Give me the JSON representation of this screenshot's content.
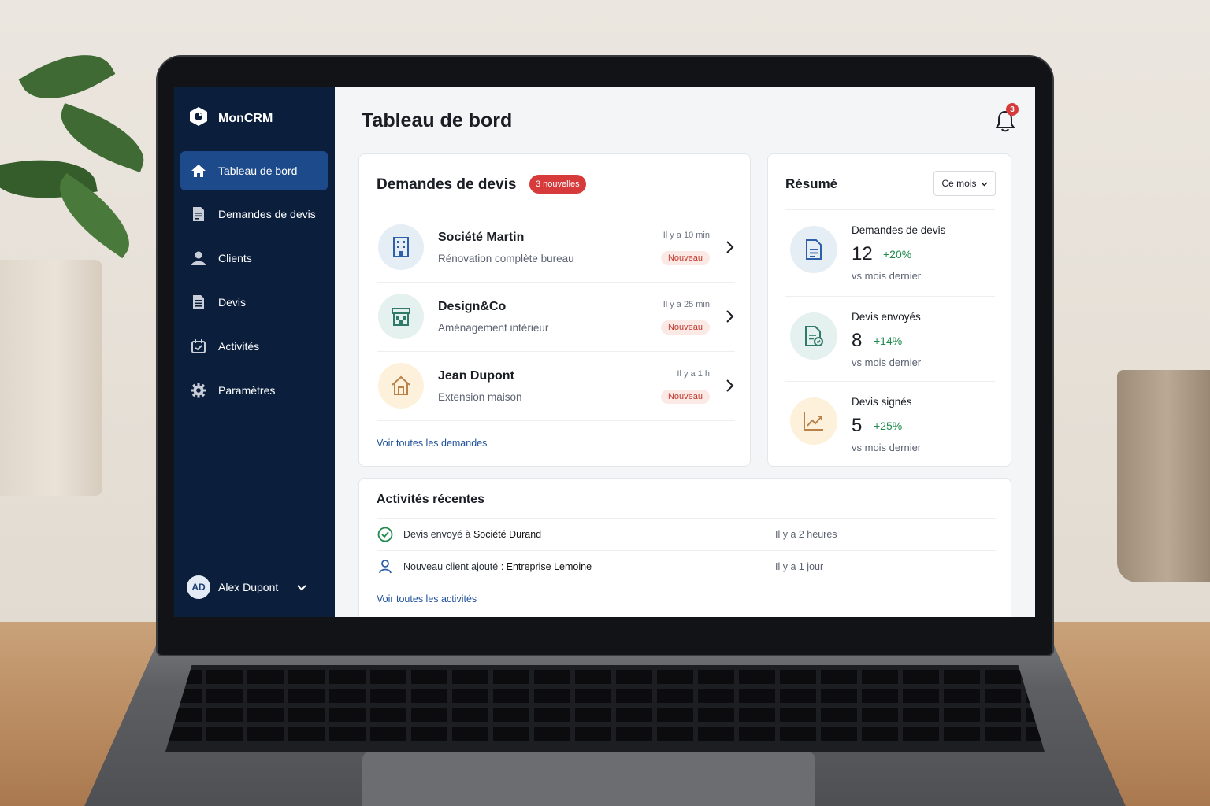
{
  "app": {
    "name": "MonCRM"
  },
  "sidebar": {
    "items": [
      {
        "label": "Tableau de bord",
        "icon": "home-icon",
        "active": true
      },
      {
        "label": "Demandes de devis",
        "icon": "document-icon",
        "active": false
      },
      {
        "label": "Clients",
        "icon": "user-icon",
        "active": false
      },
      {
        "label": "Devis",
        "icon": "file-list-icon",
        "active": false
      },
      {
        "label": "Activités",
        "icon": "calendar-icon",
        "active": false
      },
      {
        "label": "Paramètres",
        "icon": "gear-icon",
        "active": false
      }
    ],
    "user": {
      "initials": "AD",
      "name": "Alex Dupont"
    }
  },
  "header": {
    "title": "Tableau de bord",
    "notifications_count": "3"
  },
  "quotes": {
    "title": "Demandes de devis",
    "new_badge": "3 nouvelles",
    "rows": [
      {
        "name": "Société Martin",
        "description": "Rénovation complète bureau",
        "time": "Il y a 10 min",
        "status": "Nouveau",
        "icon": "building-icon"
      },
      {
        "name": "Design&Co",
        "description": "Aménagement intérieur",
        "time": "Il y a 25 min",
        "status": "Nouveau",
        "icon": "store-icon"
      },
      {
        "name": "Jean Dupont",
        "description": "Extension maison",
        "time": "Il y a 1 h",
        "status": "Nouveau",
        "icon": "house-icon"
      }
    ],
    "view_all": "Voir toutes les demandes"
  },
  "summary": {
    "title": "Résumé",
    "period": "Ce mois",
    "stats": [
      {
        "label": "Demandes de devis",
        "value": "12",
        "change": "+20%",
        "caption": "vs mois dernier",
        "icon": "document-icon"
      },
      {
        "label": "Devis envoyés",
        "value": "8",
        "change": "+14%",
        "caption": "vs mois dernier",
        "icon": "document-sent-icon"
      },
      {
        "label": "Devis signés",
        "value": "5",
        "change": "+25%",
        "caption": "vs mois dernier",
        "icon": "trend-up-icon"
      }
    ]
  },
  "activities": {
    "title": "Activités récentes",
    "rows": [
      {
        "prefix": "Devis envoyé à ",
        "subject": "Société Durand",
        "time": "Il y a 2 heures",
        "icon": "check-circle-icon"
      },
      {
        "prefix": "Nouveau client ajouté : ",
        "subject": "Entreprise Lemoine",
        "time": "Il y a 1 jour",
        "icon": "user-icon"
      }
    ],
    "view_all": "Voir toutes les activités"
  },
  "colors": {
    "sidebar_bg": "#0b1f3d",
    "sidebar_active": "#1c4a8a",
    "alert_red": "#d63a3a",
    "positive_green": "#1f8a4c",
    "link_blue": "#1c4f99"
  }
}
